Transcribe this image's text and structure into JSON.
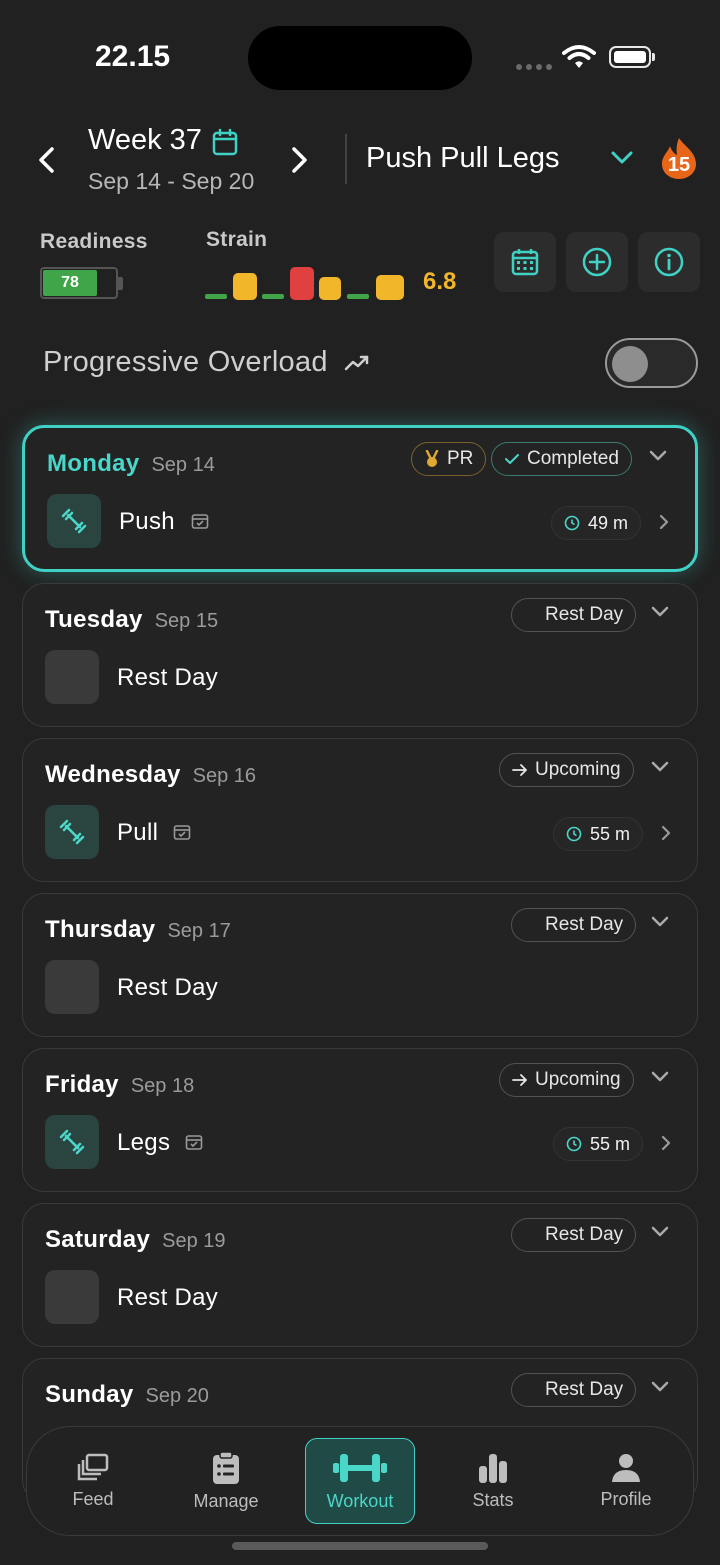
{
  "status": {
    "time": "22.15"
  },
  "header": {
    "week_title": "Week 37",
    "week_range": "Sep 14 - Sep 20",
    "program": "Push Pull Legs",
    "streak": "15"
  },
  "metrics": {
    "readiness_label": "Readiness",
    "readiness_value": "78",
    "strain_label": "Strain",
    "strain_value": "6.8"
  },
  "progressive": {
    "label": "Progressive Overload",
    "enabled": false
  },
  "days": [
    {
      "day": "Monday",
      "date": "Sep 14",
      "pr": "PR",
      "status": "Completed",
      "name": "Push",
      "duration": "49 m"
    },
    {
      "day": "Tuesday",
      "date": "Sep 15",
      "status": "Rest Day",
      "name": "Rest Day"
    },
    {
      "day": "Wednesday",
      "date": "Sep 16",
      "status": "Upcoming",
      "name": "Pull",
      "duration": "55 m"
    },
    {
      "day": "Thursday",
      "date": "Sep 17",
      "status": "Rest Day",
      "name": "Rest Day"
    },
    {
      "day": "Friday",
      "date": "Sep 18",
      "status": "Upcoming",
      "name": "Legs",
      "duration": "55 m"
    },
    {
      "day": "Saturday",
      "date": "Sep 19",
      "status": "Rest Day",
      "name": "Rest Day"
    },
    {
      "day": "Sunday",
      "date": "Sep 20",
      "status": "Rest Day"
    }
  ],
  "nav": {
    "feed": "Feed",
    "manage": "Manage",
    "workout": "Workout",
    "stats": "Stats",
    "profile": "Profile"
  },
  "colors": {
    "accent": "#3fd2c4",
    "strain": "#f2b62b",
    "readiness": "#3fa548"
  }
}
